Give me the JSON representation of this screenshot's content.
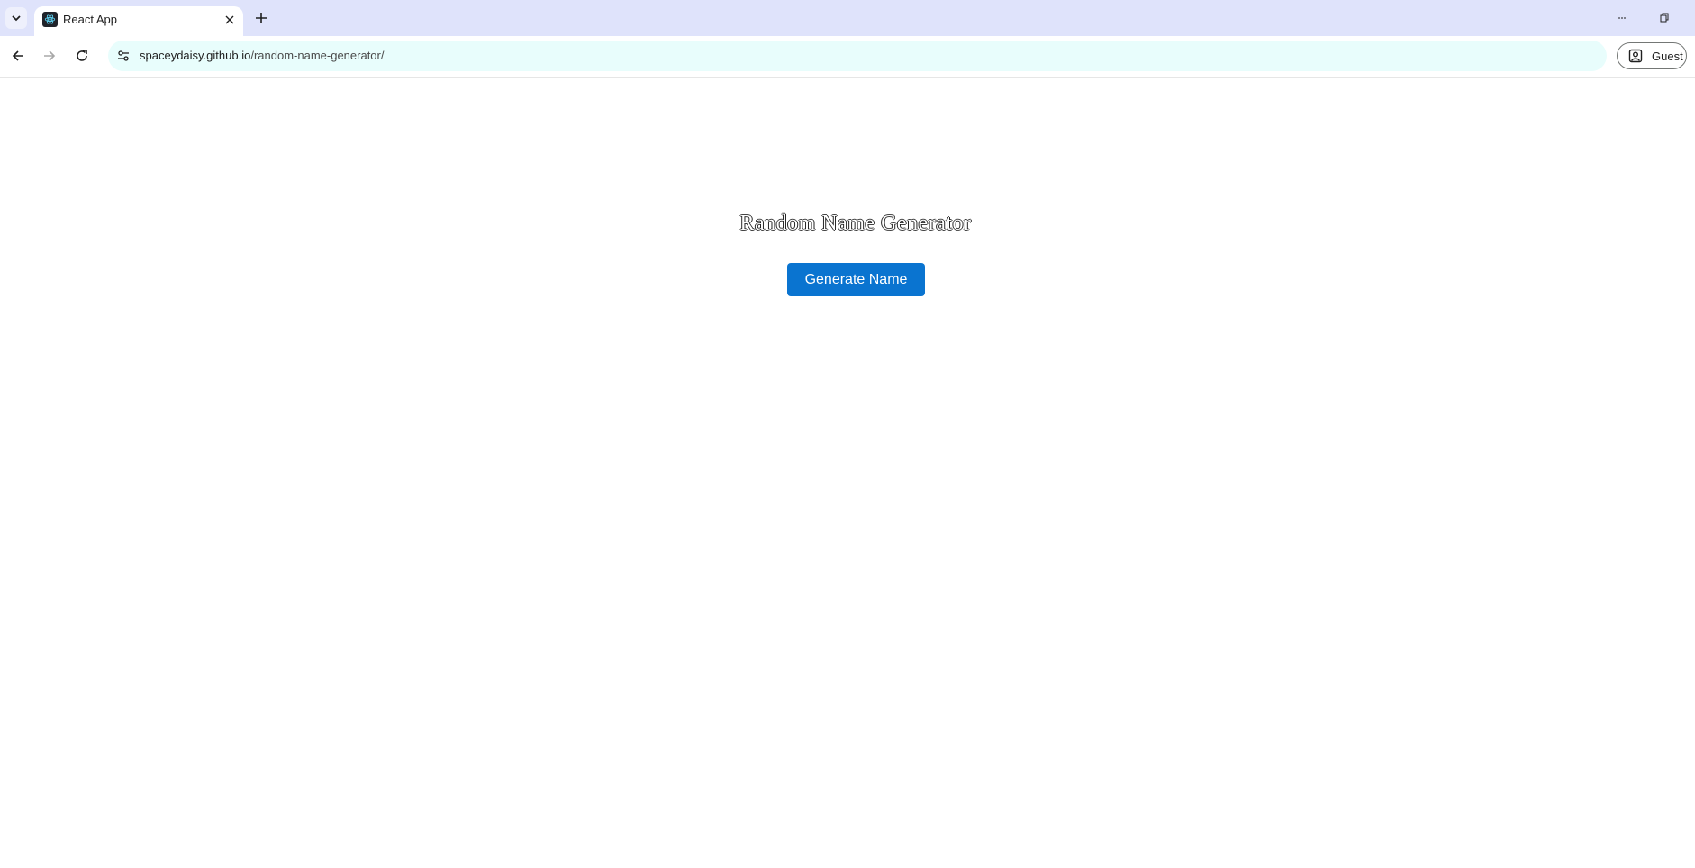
{
  "browser": {
    "tab": {
      "title": "React App",
      "favicon": "react-logo-icon"
    },
    "url": {
      "host": "spaceydaisy.github.io",
      "path": "/random-name-generator/"
    },
    "profile_label": "Guest",
    "colors": {
      "tabstrip_bg": "#dfe3fb",
      "omnibox_bg": "#e8fdfc"
    }
  },
  "app": {
    "title": "Random Name Generator",
    "generate_button_label": "Generate Name",
    "colors": {
      "button_bg": "#0a74d0",
      "button_text": "#ffffff"
    }
  }
}
